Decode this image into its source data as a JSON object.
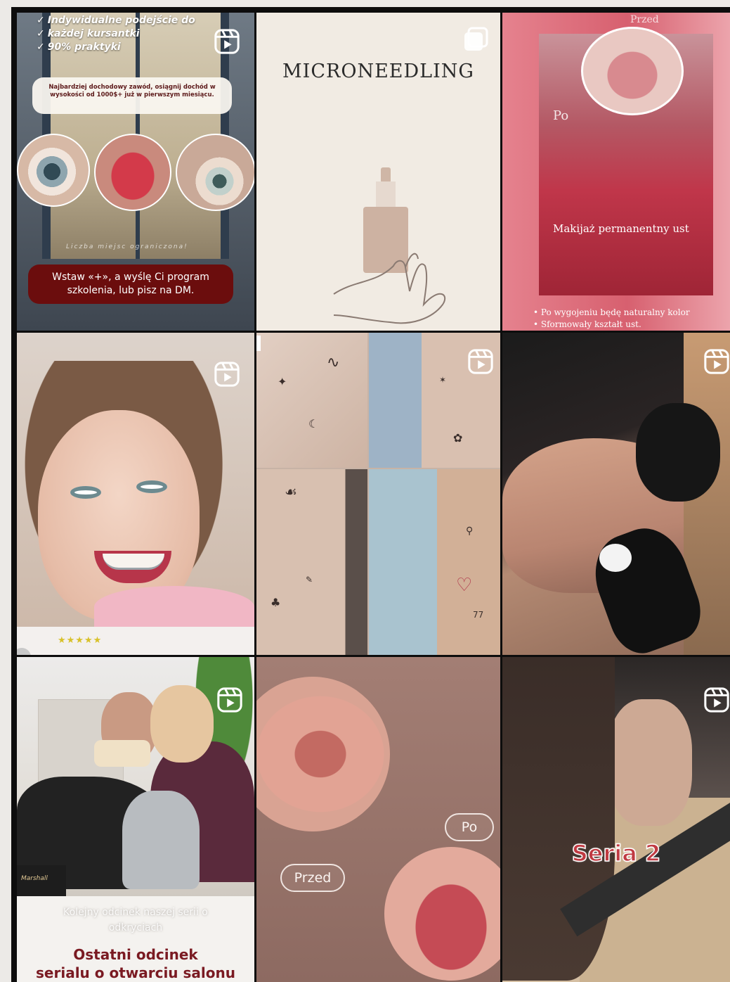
{
  "tiles": {
    "t1": {
      "bullets": [
        "Indywidualne podejście do",
        "każdej kursantki",
        "90% praktyki"
      ],
      "banner": "Najbardziej dochodowy zawód, osiągnij dochód w wysokości od 1000$+ już w pierwszym miesiącu.",
      "script_note": "Liczba miejsc ograniczona!",
      "cta": "Wstaw «+», a wyślę Ci program szkolenia, lub pisz na DM.",
      "icon": "reel-icon"
    },
    "t2": {
      "title": "MICRONEEDLING",
      "icon": "multiple-posts-icon"
    },
    "t3": {
      "label_before": "Przed",
      "label_after": "Po",
      "caption": "Makijaż permanentny ust",
      "notes": [
        "• Po wygojeniu będę naturalny kolor",
        "• Sformowały kształt ust."
      ]
    },
    "t4": {
      "rating": "★★★★★",
      "icon": "reel-icon"
    },
    "t5": {
      "icon": "reel-icon",
      "ink_numeral": "77"
    },
    "t6": {
      "icon": "reel-icon"
    },
    "t7": {
      "brand": "Marshall",
      "subtitle_line1": "Kolejny odcinek naszej serii o",
      "subtitle_line2": "odkryciach",
      "title_line1": "Ostatni odcinek",
      "title_line2": "serialu o otwarciu salonu",
      "icon": "reel-icon"
    },
    "t8": {
      "label_after": "Po",
      "label_before": "Przed"
    },
    "t9": {
      "title": "Seria 2",
      "icon": "reel-icon"
    }
  },
  "colors": {
    "cta_background": "#6b0d0d",
    "series_title": "#c03a42",
    "rating_star": "#d8c12a",
    "page_background": "#eceae7"
  }
}
